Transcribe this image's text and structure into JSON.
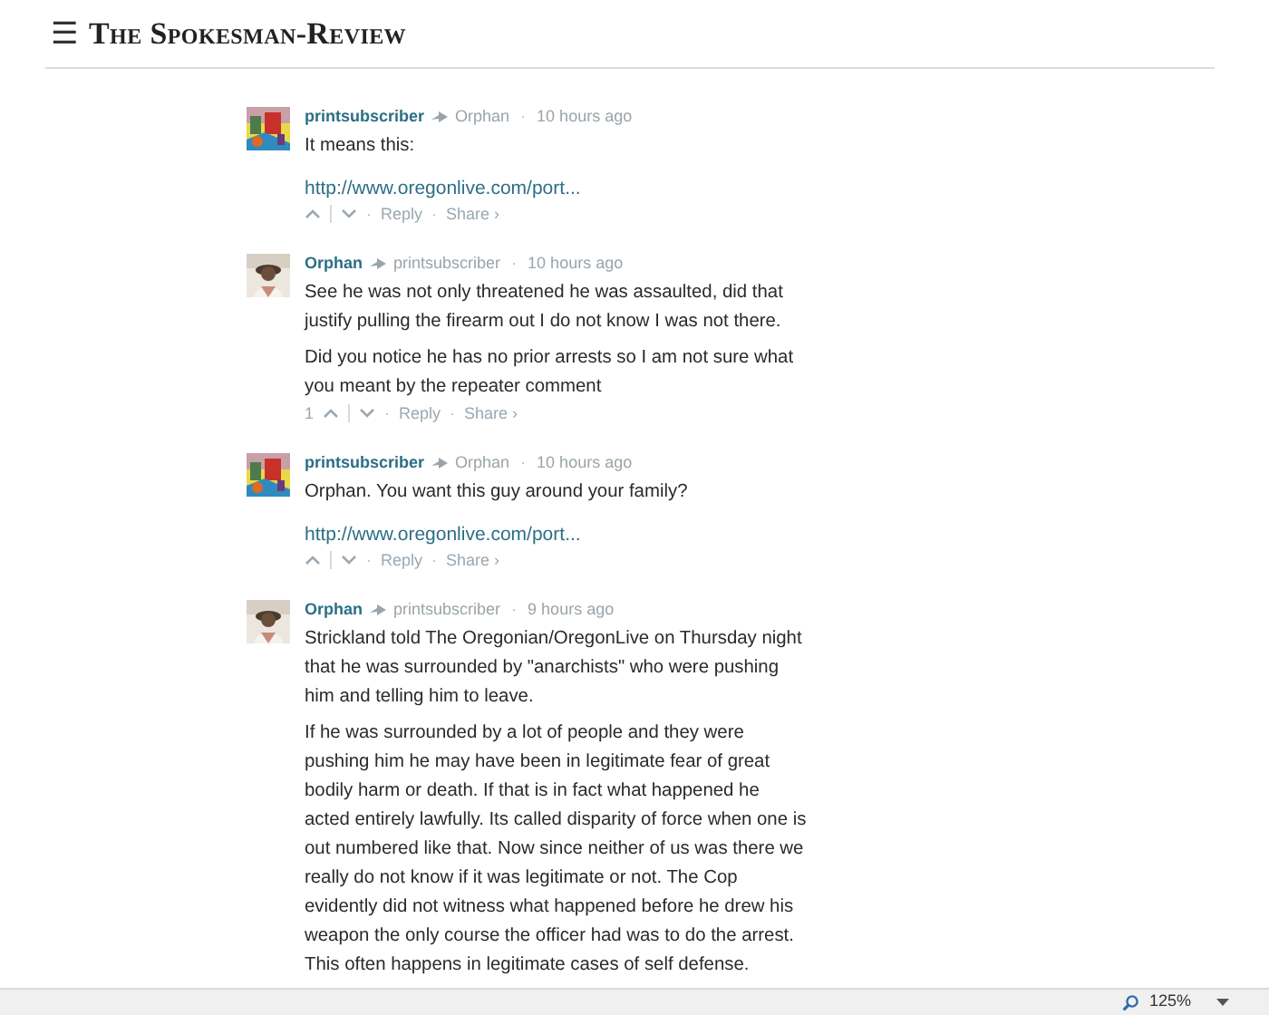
{
  "header": {
    "menu": "☰",
    "title": "The Spokesman-Review"
  },
  "comments": [
    {
      "author": "printsubscriber",
      "reply_to": "Orphan",
      "time": "10 hours ago",
      "body": [
        {
          "kind": "text",
          "text": "It means this:"
        },
        {
          "kind": "link",
          "text": "http://www.oregonlive.com/port..."
        }
      ],
      "actions": [
        "Reply",
        "Share ›"
      ]
    },
    {
      "author": "Orphan",
      "reply_to": "printsubscriber",
      "time": "10 hours ago",
      "body": [
        {
          "kind": "text",
          "text": "See he was not only threatened he was assaulted, did that justify pulling the firearm out I do not know I was not there."
        },
        {
          "kind": "text",
          "text": "Did you notice he has no prior arrests so I am not sure what you meant by the repeater comment"
        }
      ],
      "votes": "1",
      "actions": [
        "Reply",
        "Share ›"
      ]
    },
    {
      "author": "printsubscriber",
      "reply_to": "Orphan",
      "time": "10 hours ago",
      "body": [
        {
          "kind": "text",
          "text": "Orphan. You want this guy around your family?"
        },
        {
          "kind": "link",
          "text": "http://www.oregonlive.com/port..."
        }
      ],
      "actions": [
        "Reply",
        "Share ›"
      ]
    },
    {
      "author": "Orphan",
      "reply_to": "printsubscriber",
      "time": "9 hours ago",
      "body": [
        {
          "kind": "text",
          "text": "Strickland told The Oregonian/OregonLive on Thursday night that he was surrounded by \"anarchists\" who were pushing him and telling him to leave."
        },
        {
          "kind": "text",
          "text": "If he was surrounded by a lot of people and they were pushing him he may have been in legitimate fear of great bodily harm or death. If that is in fact what happened he acted entirely lawfully. Its called disparity of force when one is out numbered like that. Now since neither of us was there we really do not know if it was legitimate or not. The Cop evidently did not witness what happened before he drew his weapon the only course the officer had was to do the arrest. This often happens in legitimate cases of self defense."
        }
      ]
    }
  ],
  "separator": "·",
  "status_bar": {
    "zoom": "125%"
  }
}
